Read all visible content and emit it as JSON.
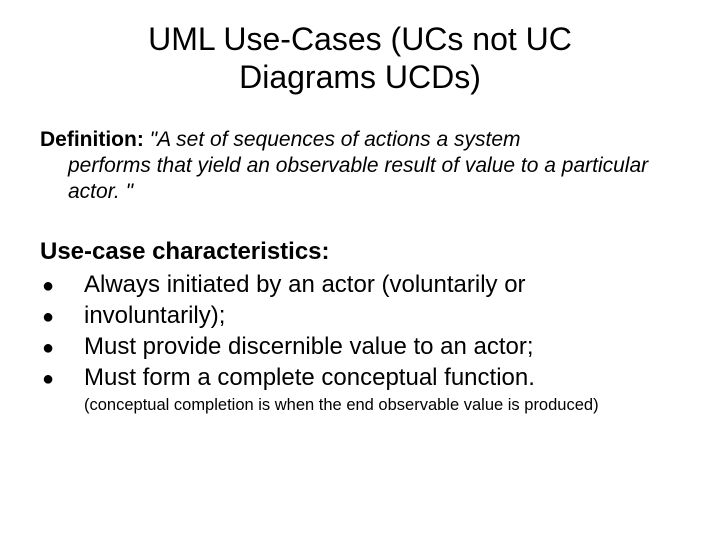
{
  "title": "UML Use-Cases (UCs not UC Diagrams UCDs)",
  "definition": {
    "label": "Definition: ",
    "text_first": "\"A set of sequences of actions a system",
    "text_rest": "performs that yield an observable result of value to a particular actor. \""
  },
  "characteristics": {
    "label": "Use-case characteristics:",
    "items": [
      "Always initiated by an actor (voluntarily or",
      "involuntarily);",
      "Must provide discernible value to an actor;",
      "Must form a complete conceptual function."
    ],
    "footnote": "(conceptual completion is when the end observable value is produced)"
  }
}
